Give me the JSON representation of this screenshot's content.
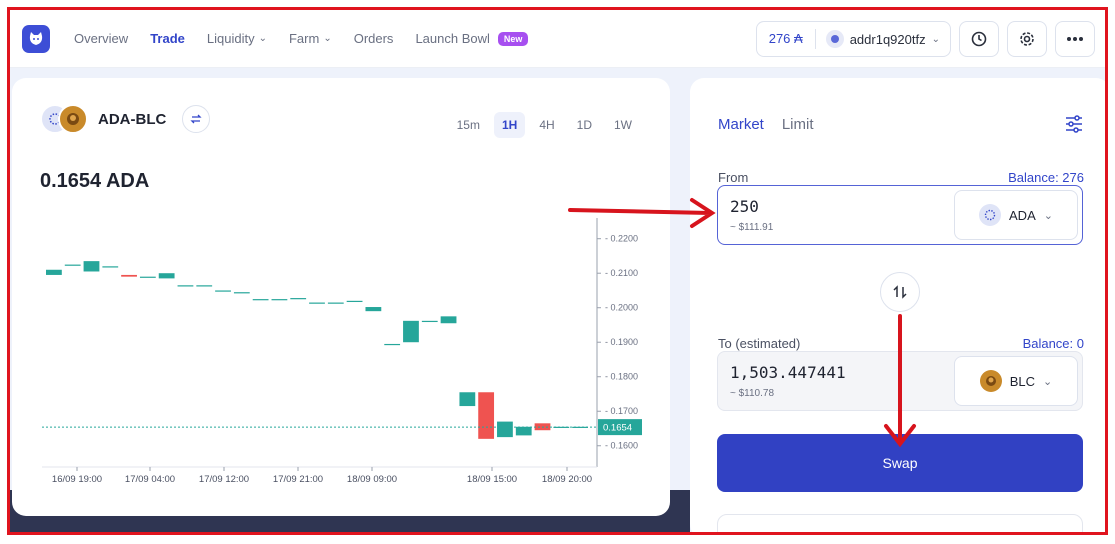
{
  "nav": {
    "logo": "cat-logo-icon",
    "items": [
      {
        "label": "Overview",
        "active": false,
        "dropdown": false
      },
      {
        "label": "Trade",
        "active": true,
        "dropdown": false
      },
      {
        "label": "Liquidity",
        "active": false,
        "dropdown": true
      },
      {
        "label": "Farm",
        "active": false,
        "dropdown": true
      },
      {
        "label": "Orders",
        "active": false,
        "dropdown": false
      },
      {
        "label": "Launch Bowl",
        "active": false,
        "dropdown": false
      }
    ],
    "new_badge": "New",
    "balance": "276 ₳",
    "address": "addr1q920tfz",
    "icons": [
      "history-icon",
      "gear-icon",
      "more-icon"
    ]
  },
  "chart_panel": {
    "pair": "ADA-BLC",
    "price": "0.1654 ADA",
    "timeframes": [
      "15m",
      "1H",
      "4H",
      "1D",
      "1W"
    ],
    "active_timeframe": "1H",
    "current_price_tag": "0.1654"
  },
  "chart_data": {
    "type": "candlestick",
    "ylim": [
      0.155,
      0.226
    ],
    "yticks": [
      "0.2200",
      "0.2100",
      "0.2000",
      "0.1900",
      "0.1800",
      "0.1700",
      "0.1600"
    ],
    "xticks": [
      "16/09 19:00",
      "17/09 04:00",
      "17/09 12:00",
      "17/09 21:00",
      "18/09 09:00",
      "18/09 15:00",
      "18/09 20:00"
    ],
    "current_price": 0.1654,
    "colors": {
      "up": "#26a69a",
      "down": "#ef5350"
    },
    "candles": [
      {
        "o": 0.2095,
        "c": 0.211
      },
      {
        "o": 0.2125,
        "c": 0.2125
      },
      {
        "o": 0.2105,
        "c": 0.2135
      },
      {
        "o": 0.212,
        "c": 0.212
      },
      {
        "o": 0.2095,
        "c": 0.209
      },
      {
        "o": 0.209,
        "c": 0.209
      },
      {
        "o": 0.2085,
        "c": 0.21
      },
      {
        "o": 0.2065,
        "c": 0.2065
      },
      {
        "o": 0.2065,
        "c": 0.2065
      },
      {
        "o": 0.205,
        "c": 0.205
      },
      {
        "o": 0.2045,
        "c": 0.2045
      },
      {
        "o": 0.2025,
        "c": 0.2025
      },
      {
        "o": 0.2025,
        "c": 0.2025
      },
      {
        "o": 0.2028,
        "c": 0.2028
      },
      {
        "o": 0.2015,
        "c": 0.2015
      },
      {
        "o": 0.2015,
        "c": 0.2015
      },
      {
        "o": 0.202,
        "c": 0.202
      },
      {
        "o": 0.199,
        "c": 0.2002
      },
      {
        "o": 0.1895,
        "c": 0.1895
      },
      {
        "o": 0.19,
        "c": 0.1962
      },
      {
        "o": 0.1962,
        "c": 0.1962
      },
      {
        "o": 0.1955,
        "c": 0.1975
      },
      {
        "o": 0.1715,
        "c": 0.1755
      },
      {
        "o": 0.1755,
        "c": 0.162
      },
      {
        "o": 0.1625,
        "c": 0.167
      },
      {
        "o": 0.163,
        "c": 0.1655
      },
      {
        "o": 0.1665,
        "c": 0.1645
      },
      {
        "o": 0.1655,
        "c": 0.1655
      },
      {
        "o": 0.1655,
        "c": 0.1655
      }
    ]
  },
  "swap": {
    "tabs": [
      "Market",
      "Limit"
    ],
    "active_tab": "Market",
    "from": {
      "label": "From",
      "balance": "Balance: 276",
      "amount": "250",
      "usd": "~ $111.91",
      "token": "ADA"
    },
    "to": {
      "label": "To (estimated)",
      "balance": "Balance: 0",
      "amount": "1,503.447441",
      "usd": "~ $110.78",
      "token": "BLC"
    },
    "button": "Swap"
  },
  "annotation_colors": {
    "frame": "#e0141e",
    "arrows": "#d7141d"
  }
}
